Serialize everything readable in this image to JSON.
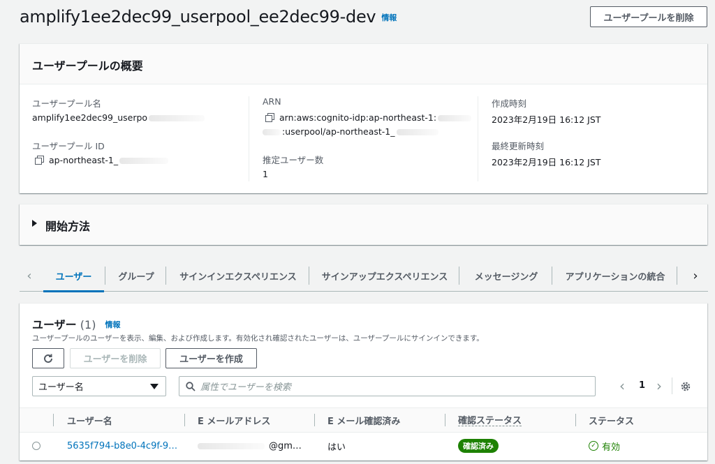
{
  "header": {
    "title": "amplify1ee2dec99_userpool_ee2dec99-dev",
    "info_link": "情報",
    "delete_pool_button": "ユーザープールを削除"
  },
  "overview": {
    "title": "ユーザープールの概要",
    "pool_name_label": "ユーザープール名",
    "pool_name_value": "amplify1ee2dec99_userpo",
    "pool_id_label": "ユーザープール ID",
    "pool_id_value": "ap-northeast-1_",
    "arn_label": "ARN",
    "arn_value_line1": "arn:aws:cognito-idp:ap-northeast-1:",
    "arn_value_line2": ":userpool/ap-northeast-1_",
    "estimated_users_label": "推定ユーザー数",
    "estimated_users_value": "1",
    "created_label": "作成時刻",
    "created_value": "2023年2月19日 16:12 JST",
    "updated_label": "最終更新時刻",
    "updated_value": "2023年2月19日 16:12 JST"
  },
  "getting_started": {
    "title": "開始方法"
  },
  "tabs": [
    {
      "label": "ユーザー",
      "active": true
    },
    {
      "label": "グループ"
    },
    {
      "label": "サインインエクスペリエンス"
    },
    {
      "label": "サインアップエクスペリエンス"
    },
    {
      "label": "メッセージング"
    },
    {
      "label": "アプリケーションの統合"
    }
  ],
  "users": {
    "title": "ユーザー",
    "count": "(1)",
    "info_link": "情報",
    "description": "ユーザープールのユーザーを表示、編集、および作成します。有効化され確認されたユーザーは、ユーザープールにサインインできます。",
    "delete_button": "ユーザーを削除",
    "create_button": "ユーザーを作成",
    "filter_select": "ユーザー名",
    "search_placeholder": "属性でユーザーを検索",
    "page_number": "1",
    "columns": [
      "ユーザー名",
      "E メールアドレス",
      "E メール確認済み",
      "確認ステータス",
      "ステータス"
    ],
    "rows": [
      {
        "username": "5635f794-b8e0-4c9f-9…",
        "email": "@gm…",
        "email_verified": "はい",
        "confirmation_status": "確認済み",
        "status": "有効"
      }
    ]
  },
  "colors": {
    "link": "#0073bb",
    "success": "#1d8102",
    "background": "#f2f3f3"
  }
}
